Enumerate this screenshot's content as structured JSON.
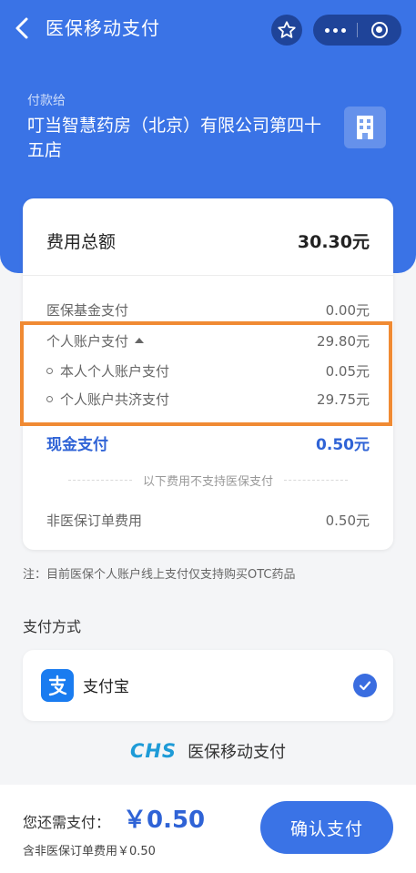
{
  "nav": {
    "title": "医保移动支付"
  },
  "payee": {
    "label": "付款给",
    "name": "叮当智慧药房（北京）有限公司第四十五店"
  },
  "bill": {
    "total_label": "费用总额",
    "total_amount": "30.30元",
    "fund_label": "医保基金支付",
    "fund_amount": "0.00元",
    "personal_label": "个人账户支付",
    "personal_amount": "29.80元",
    "self_label": "本人个人账户支付",
    "self_amount": "0.05元",
    "shared_label": "个人账户共济支付",
    "shared_amount": "29.75元",
    "cash_label": "现金支付",
    "cash_amount": "0.50元",
    "notice": "以下费用不支持医保支付",
    "non_insured_label": "非医保订单费用",
    "non_insured_amount": "0.50元"
  },
  "note": "注：目前医保个人账户线上支付仅支持购买OTC药品",
  "payment": {
    "section_title": "支付方式",
    "method_name": "支付宝"
  },
  "brand": {
    "logo_text": "CHS",
    "name": "医保移动支付"
  },
  "footer": {
    "pay_label": "您还需支付：",
    "pay_amount": "￥0.50",
    "sub_text": "含非医保订单费用￥0.50",
    "confirm_label": "确认支付"
  },
  "colors": {
    "primary": "#3a73e6",
    "accent_text": "#2f63d6",
    "highlight": "#f08a33",
    "alipay": "#1a7cf0",
    "chs_logo": "#1e9bd7"
  },
  "icons": {
    "back": "chevron-left-icon",
    "favorite": "star-icon",
    "more": "more-dots-icon",
    "close": "target-icon",
    "store": "building-icon",
    "alipay": "alipay-icon",
    "selected": "check-icon"
  }
}
